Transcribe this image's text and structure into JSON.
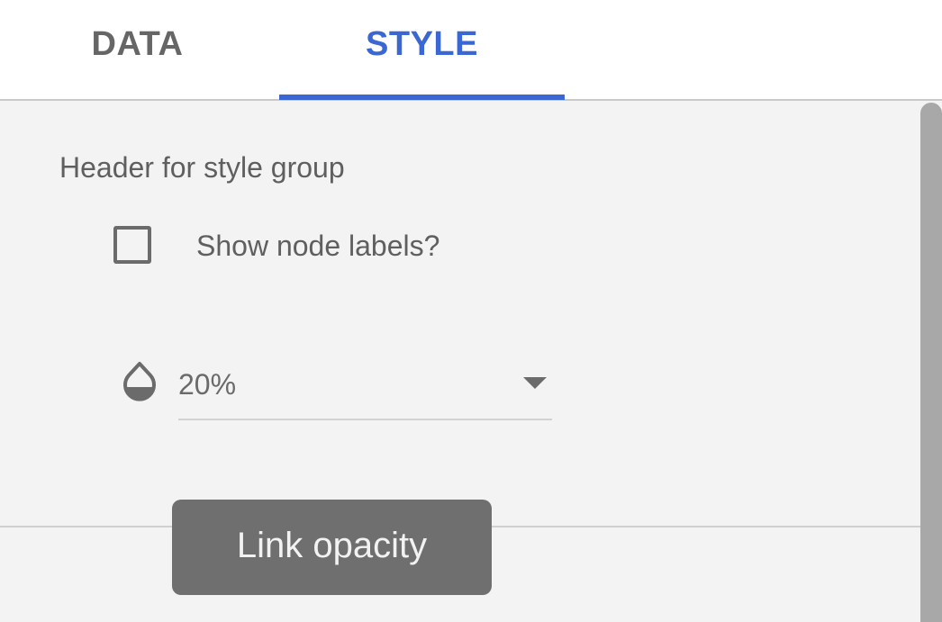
{
  "tabs": [
    {
      "label": "DATA",
      "active": false
    },
    {
      "label": "STYLE",
      "active": true
    }
  ],
  "style_panel": {
    "group_header": "Header for style group",
    "show_node_labels": {
      "label": "Show node labels?",
      "checked": false
    },
    "opacity_select": {
      "icon": "opacity-drop-icon",
      "value": "20%"
    }
  },
  "tooltip": {
    "text": "Link opacity"
  },
  "colors": {
    "accent": "#3a67d1",
    "background": "#f3f3f3",
    "tooltip_bg": "#6f6f6f"
  }
}
